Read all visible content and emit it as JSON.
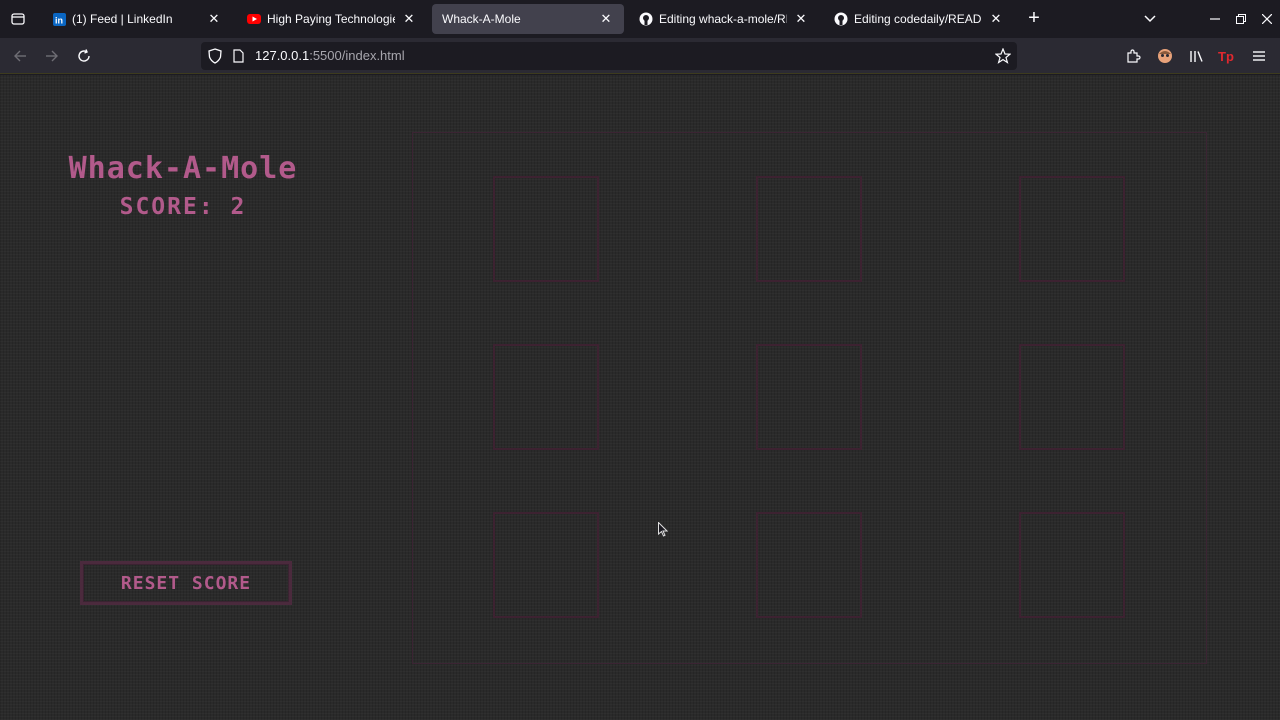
{
  "browser": {
    "tabs": [
      {
        "title": "(1) Feed | LinkedIn",
        "icon": "linkedin-icon",
        "active": false
      },
      {
        "title": "High Paying Technologie",
        "icon": "youtube-icon",
        "active": false
      },
      {
        "title": "Whack-A-Mole",
        "icon": "",
        "active": true
      },
      {
        "title": "Editing whack-a-mole/RE",
        "icon": "github-icon",
        "active": false
      },
      {
        "title": "Editing codedaily/READI",
        "icon": "github-icon",
        "active": false
      }
    ],
    "url_host": "127.0.0.1",
    "url_path": ":5500/index.html",
    "new_tab_label": "+"
  },
  "game": {
    "title": "Whack-A-Mole",
    "score_text": "SCORE: 2",
    "score": 2,
    "reset_label": "RESET SCORE",
    "holes": 9,
    "accent_color": "#b25a8b",
    "border_color": "#3d2231"
  }
}
